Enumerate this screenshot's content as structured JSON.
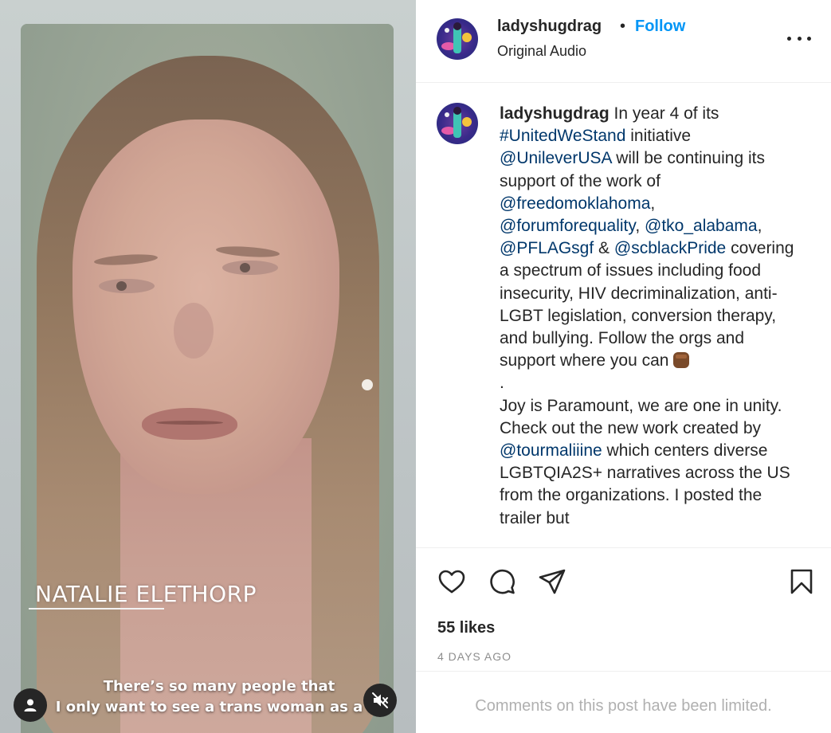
{
  "video": {
    "name_caption": "NATALIE ELETHORP",
    "subtitle_line1": "There’s so many people that",
    "subtitle_line2": "I only want to see a trans woman as a m"
  },
  "header": {
    "username": "ladyshugdrag",
    "separator": "•",
    "follow_label": "Follow",
    "audio_label": "Original Audio"
  },
  "caption": {
    "username": "ladyshugdrag",
    "t1": " In year 4 of its ",
    "hashtag": "#UnitedWeStand",
    "t2": " initiative ",
    "m1": "@UnileverUSA",
    "t3": " will be continuing its support of the work of ",
    "m2": "@freedomoklahoma",
    "t4": ", ",
    "m3": "@forumforequality",
    "t5": ", ",
    "m4": "@tko_alabama",
    "t6": ", ",
    "m5": "@PFLAGsgf",
    "t7": " & ",
    "m6": "@scblackPride",
    "t8": " covering a spectrum of issues including food insecurity, HIV decriminalization, anti-LGBT legislation, conversion therapy, and bullying. Follow the orgs and support where you can",
    "dot": ".",
    "t9": "Joy is Paramount, we are one in unity. Check out the new work created by ",
    "m7": "@tourmaliiine",
    "t10": " which centers diverse LGBTQIA2S+ narratives across the US from the organizations. I posted the trailer but"
  },
  "actions": {
    "likes": "55 likes",
    "timestamp": "4 DAYS AGO"
  },
  "comments": {
    "limited_text": "Comments on this post have been limited."
  },
  "icons": {
    "like": "heart-icon",
    "comment": "comment-icon",
    "share": "paper-plane-icon",
    "save": "bookmark-icon",
    "more": "more-dots-icon",
    "user": "user-icon",
    "mute": "speaker-muted-icon"
  },
  "colors": {
    "follow": "#0095f6",
    "mention": "#00376b",
    "secondary": "#8e8e8e"
  }
}
